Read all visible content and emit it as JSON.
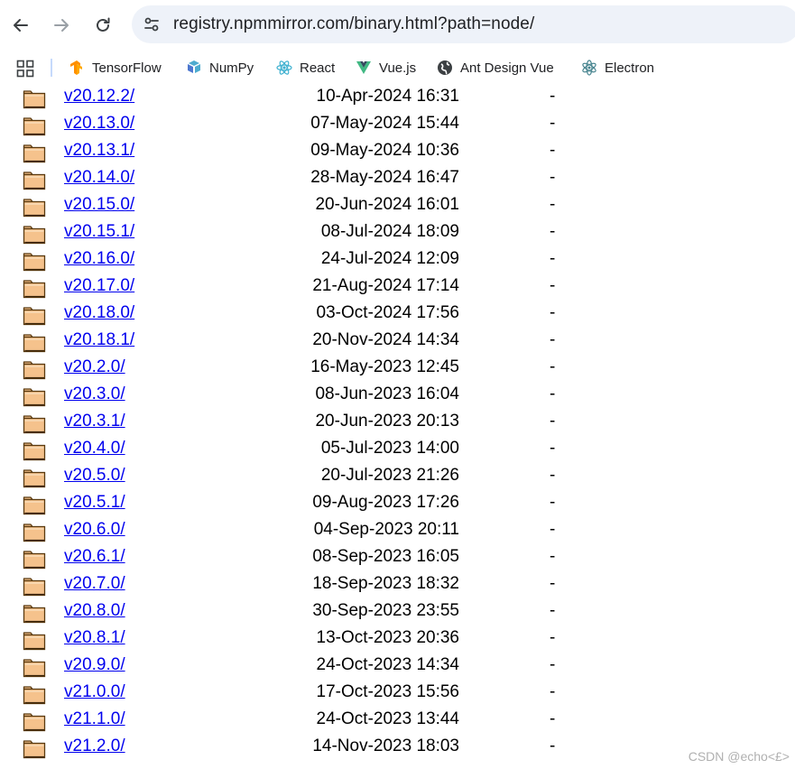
{
  "toolbar": {
    "url": "registry.npmmirror.com/binary.html?path=node/"
  },
  "bookmarks": [
    {
      "label": "TensorFlow",
      "icon": "tensorflow-icon",
      "color": "#ff8f00"
    },
    {
      "label": "NumPy",
      "icon": "numpy-icon",
      "color": "#4dabcf"
    },
    {
      "label": "React",
      "icon": "react-icon",
      "color": "#61dafb"
    },
    {
      "label": "Vue.js",
      "icon": "vue-icon",
      "color": "#41b883"
    },
    {
      "label": "Ant Design Vue",
      "icon": "globe-icon",
      "color": "#3c4043"
    },
    {
      "label": "Electron",
      "icon": "electron-icon",
      "color": "#47848f"
    }
  ],
  "listing": {
    "rows": [
      {
        "name": "v20.12.2/",
        "date": "10-Apr-2024 16:31",
        "size": "-"
      },
      {
        "name": "v20.13.0/",
        "date": "07-May-2024 15:44",
        "size": "-"
      },
      {
        "name": "v20.13.1/",
        "date": "09-May-2024 10:36",
        "size": "-"
      },
      {
        "name": "v20.14.0/",
        "date": "28-May-2024 16:47",
        "size": "-"
      },
      {
        "name": "v20.15.0/",
        "date": "20-Jun-2024 16:01",
        "size": "-"
      },
      {
        "name": "v20.15.1/",
        "date": "08-Jul-2024 18:09",
        "size": "-"
      },
      {
        "name": "v20.16.0/",
        "date": "24-Jul-2024 12:09",
        "size": "-"
      },
      {
        "name": "v20.17.0/",
        "date": "21-Aug-2024 17:14",
        "size": "-"
      },
      {
        "name": "v20.18.0/",
        "date": "03-Oct-2024 17:56",
        "size": "-"
      },
      {
        "name": "v20.18.1/",
        "date": "20-Nov-2024 14:34",
        "size": "-"
      },
      {
        "name": "v20.2.0/",
        "date": "16-May-2023 12:45",
        "size": "-"
      },
      {
        "name": "v20.3.0/",
        "date": "08-Jun-2023 16:04",
        "size": "-"
      },
      {
        "name": "v20.3.1/",
        "date": "20-Jun-2023 20:13",
        "size": "-"
      },
      {
        "name": "v20.4.0/",
        "date": "05-Jul-2023 14:00",
        "size": "-"
      },
      {
        "name": "v20.5.0/",
        "date": "20-Jul-2023 21:26",
        "size": "-"
      },
      {
        "name": "v20.5.1/",
        "date": "09-Aug-2023 17:26",
        "size": "-"
      },
      {
        "name": "v20.6.0/",
        "date": "04-Sep-2023 20:11",
        "size": "-"
      },
      {
        "name": "v20.6.1/",
        "date": "08-Sep-2023 16:05",
        "size": "-"
      },
      {
        "name": "v20.7.0/",
        "date": "18-Sep-2023 18:32",
        "size": "-"
      },
      {
        "name": "v20.8.0/",
        "date": "30-Sep-2023 23:55",
        "size": "-"
      },
      {
        "name": "v20.8.1/",
        "date": "13-Oct-2023 20:36",
        "size": "-"
      },
      {
        "name": "v20.9.0/",
        "date": "24-Oct-2023 14:34",
        "size": "-"
      },
      {
        "name": "v21.0.0/",
        "date": "17-Oct-2023 15:56",
        "size": "-"
      },
      {
        "name": "v21.1.0/",
        "date": "24-Oct-2023 13:44",
        "size": "-"
      },
      {
        "name": "v21.2.0/",
        "date": "14-Nov-2023 18:03",
        "size": "-"
      }
    ]
  },
  "colors": {
    "link": "#0000ee",
    "folder_fill": "#f5c28c",
    "folder_stroke": "#5a3a10",
    "omnibox": "#eef2f9"
  },
  "watermark": "CSDN @echo<£>"
}
